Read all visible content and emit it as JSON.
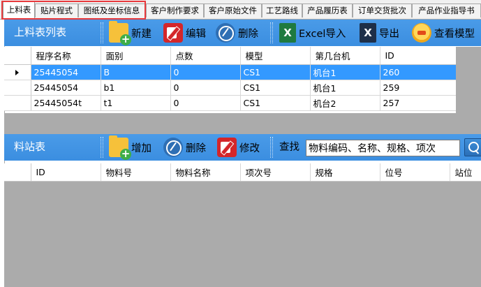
{
  "tabs": [
    {
      "label": "上料表",
      "active": true
    },
    {
      "label": "贴片程式",
      "active": false
    },
    {
      "label": "图纸及坐标信息",
      "active": false
    },
    {
      "label": "客户制作要求",
      "active": false
    },
    {
      "label": "客户原始文件",
      "active": false
    },
    {
      "label": "工艺路线",
      "active": false
    },
    {
      "label": "产品履历表",
      "active": false
    },
    {
      "label": "订单交货批次",
      "active": false
    },
    {
      "label": "产品作业指导书",
      "active": false
    }
  ],
  "feeder_list": {
    "title": "上料表列表",
    "buttons": {
      "new": "新建",
      "edit": "编辑",
      "delete": "删除",
      "excel_import": "Excel导入",
      "export": "导出",
      "view_model": "查看模型"
    },
    "columns": [
      "程序名称",
      "面别",
      "点数",
      "模型",
      "第几台机",
      "ID"
    ],
    "rows": [
      [
        "25445054",
        "B",
        "0",
        "CS1",
        "机台1",
        "260"
      ],
      [
        "25445054",
        "b1",
        "0",
        "CS1",
        "机台1",
        "259"
      ],
      [
        "25445054t",
        "t1",
        "0",
        "CS1",
        "机台2",
        "257"
      ]
    ],
    "selected_row": 0
  },
  "station_table": {
    "title": "料站表",
    "buttons": {
      "add": "增加",
      "delete": "删除",
      "modify": "修改"
    },
    "find_label": "查找",
    "search_value": "物料编码、名称、规格、项次",
    "columns": [
      "ID",
      "物料号",
      "物料名称",
      "项次号",
      "规格",
      "位号",
      "站位"
    ]
  },
  "colors": {
    "toolbar": "#3b8ee0",
    "selection": "#3399ff",
    "empty_area": "#ababab",
    "highlight_border": "#e8393c"
  }
}
